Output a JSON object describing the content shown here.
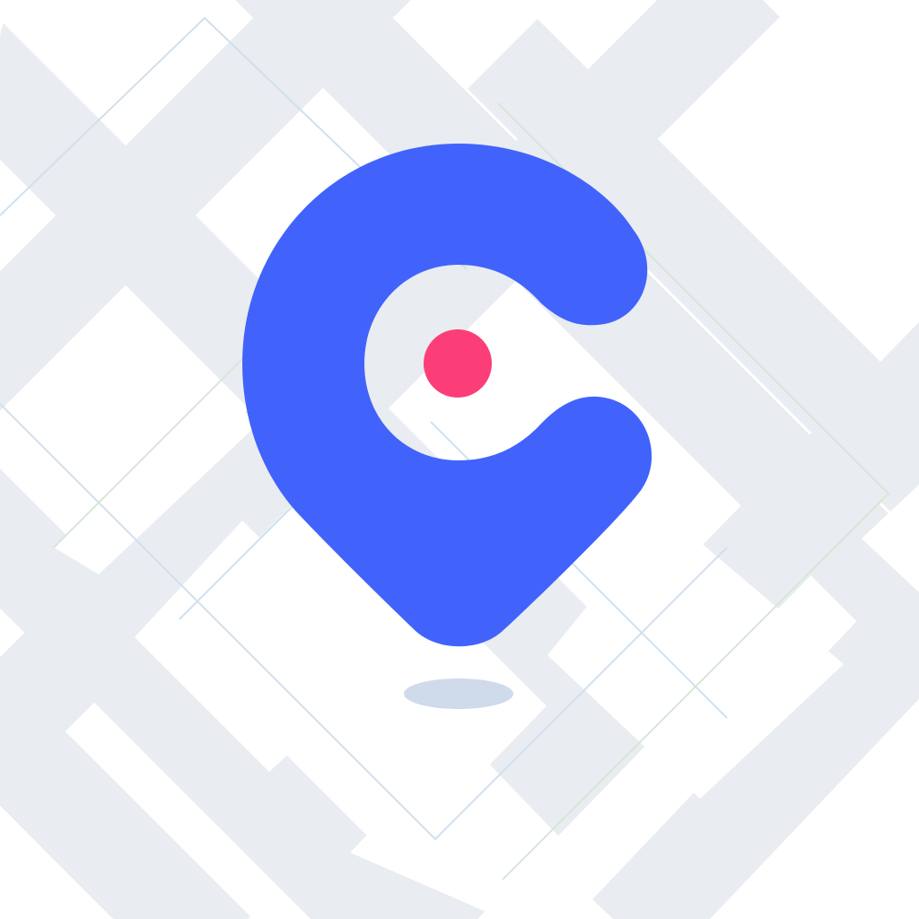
{
  "icon": {
    "semantic_name": "location-pin-c-icon",
    "description_visible_text": ""
  },
  "colors": {
    "background": "#ffffff",
    "map_road": "#e9ecf0",
    "map_block": "#ffffff",
    "map_line_blue": "#cfe0ef",
    "map_line_green": "#d6e7d6",
    "pin": "#4163fb",
    "dot": "#fc3e78",
    "shadow": "#cfdaea"
  }
}
